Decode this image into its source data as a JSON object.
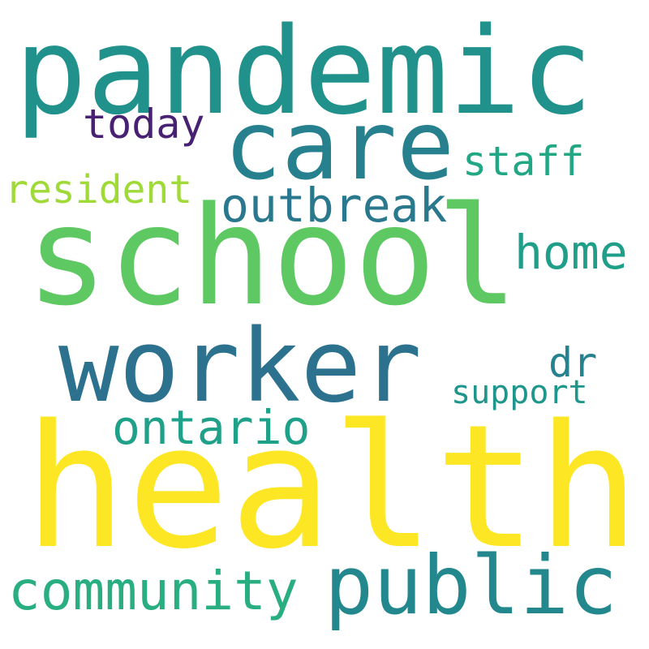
{
  "words": {
    "health": {
      "text": "health",
      "color": "#fde725"
    },
    "school": {
      "text": "school",
      "color": "#5ec962"
    },
    "pandemic": {
      "text": "pandemic",
      "color": "#21918c"
    },
    "worker": {
      "text": "worker",
      "color": "#2c728e"
    },
    "care": {
      "text": "care",
      "color": "#27808e"
    },
    "public": {
      "text": "public",
      "color": "#23888e"
    },
    "community": {
      "text": "community",
      "color": "#28ae80"
    },
    "outbreak": {
      "text": "outbreak",
      "color": "#2a788e"
    },
    "ontario": {
      "text": "ontario",
      "color": "#1fa088"
    },
    "home": {
      "text": "home",
      "color": "#1f9e89"
    },
    "today": {
      "text": "today",
      "color": "#482173"
    },
    "staff": {
      "text": "staff",
      "color": "#22a785"
    },
    "resident": {
      "text": "resident",
      "color": "#a0da39"
    },
    "dr": {
      "text": "dr",
      "color": "#26828e"
    },
    "support": {
      "text": "support",
      "color": "#1f968b"
    }
  }
}
